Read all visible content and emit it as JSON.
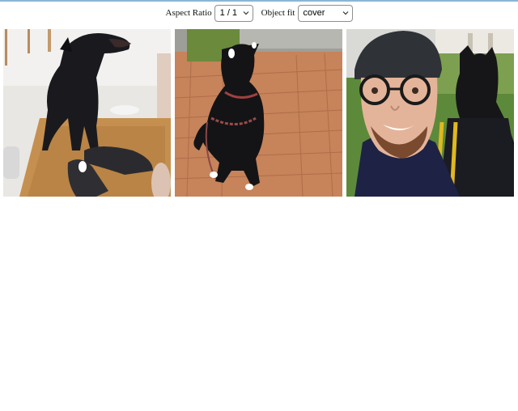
{
  "controls": {
    "aspect_ratio_label": "Aspect Ratio",
    "aspect_ratio_value": "1 / 1",
    "object_fit_label": "Object fit",
    "object_fit_value": "cover"
  },
  "photos": [
    {
      "subject": "dog-standing-on-shoes"
    },
    {
      "subject": "dog-sitting-on-brick-path"
    },
    {
      "subject": "man-selfie-with-dog-in-backpack"
    }
  ],
  "colors": {
    "accent_line": "#8ab6d6"
  }
}
